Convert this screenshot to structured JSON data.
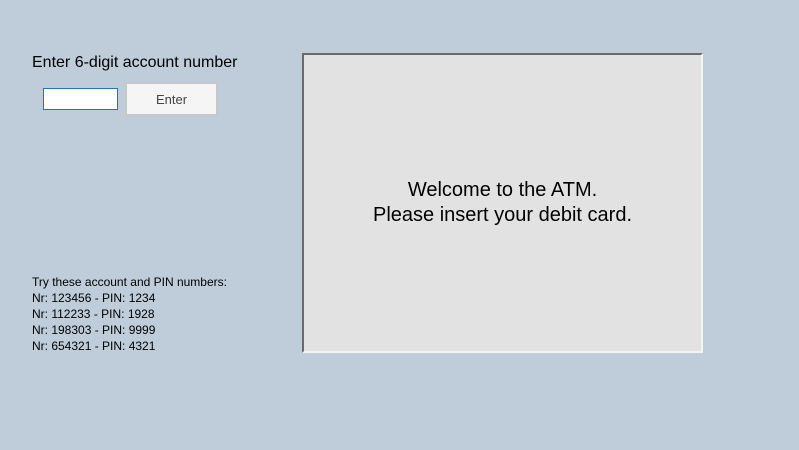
{
  "account_entry": {
    "label": "Enter 6-digit account number",
    "input_value": "",
    "button_label": "Enter"
  },
  "atm_screen": {
    "line1": "Welcome to the ATM.",
    "line2": "Please insert your debit card."
  },
  "hints": {
    "heading": "Try these account and PIN numbers:",
    "accounts": [
      "Nr: 123456 - PIN: 1234",
      "Nr: 112233 - PIN: 1928",
      "Nr: 198303 - PIN: 9999",
      "Nr: 654321 - PIN: 4321"
    ]
  },
  "colors": {
    "background": "#bfccd9",
    "screen": "#e2e2e2",
    "input_focus_border": "#1f74c6"
  }
}
